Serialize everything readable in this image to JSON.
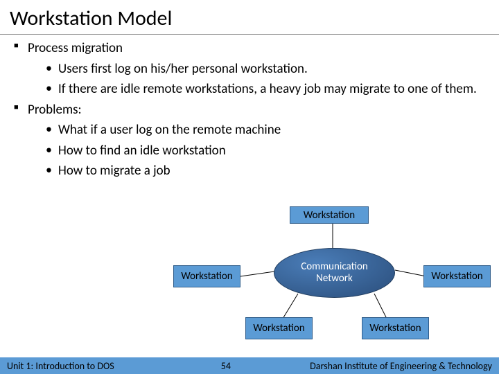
{
  "title": "Workstation Model",
  "bullets": {
    "b1": "Process migration",
    "b1a": "Users first log on his/her personal workstation.",
    "b1b": "If there are idle remote workstations, a heavy job may migrate to one of them.",
    "b2": "Problems:",
    "b2a": "What if a user log on the remote machine",
    "b2b": "How to find an idle workstation",
    "b2c": "How to migrate a job"
  },
  "diagram": {
    "ws_top": "Workstation",
    "ws_left": "Workstation",
    "ws_right": "Workstation",
    "ws_bl": "Workstation",
    "ws_br": "Workstation",
    "net1": "Communication",
    "net2": "Network"
  },
  "footer": {
    "left": "Unit 1: Introduction to DOS",
    "center": "54",
    "right": "Darshan Institute of Engineering & Technology"
  }
}
